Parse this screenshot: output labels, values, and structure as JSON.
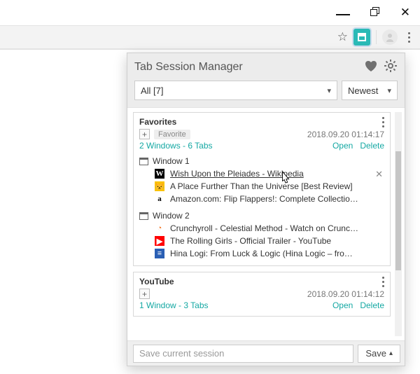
{
  "toolbar": {
    "star": "☆"
  },
  "popup": {
    "title": "Tab Session Manager",
    "filter_all": "All [7]",
    "sort": "Newest",
    "save_placeholder": "Save current session",
    "save_btn": "Save",
    "open": "Open",
    "delete": "Delete"
  },
  "sessions": [
    {
      "title": "Favorites",
      "fav_badge": "Favorite",
      "show_badge": true,
      "timestamp": "2018.09.20 01:14:17",
      "summary": "2 Windows - 6 Tabs",
      "windows": [
        {
          "label": "Window 1",
          "tabs": [
            {
              "icon": "W",
              "icon_bg": "#000",
              "icon_color": "#fff",
              "title": "Wish Upon the Pleiades - Wikipedia",
              "hover": true,
              "close": true
            },
            {
              "icon": "😾",
              "icon_bg": "#f9c200",
              "icon_color": "#000",
              "title": "A Place Further Than the Universe [Best Review]"
            },
            {
              "icon": "a",
              "icon_bg": "#fff",
              "icon_color": "#000",
              "title": "Amazon.com: Flip Flappers!: Complete Collection P…"
            }
          ]
        },
        {
          "label": "Window 2",
          "tabs": [
            {
              "icon": "◔",
              "icon_bg": "#fff",
              "icon_color": "#f47521",
              "title": "Crunchyroll - Celestial Method - Watch on Crunchyroll"
            },
            {
              "icon": "▶",
              "icon_bg": "#ff0000",
              "icon_color": "#fff",
              "title": "The Rolling Girls - Official Trailer - YouTube"
            },
            {
              "icon": "≡",
              "icon_bg": "#2a5fb4",
              "icon_color": "#fff",
              "title": "Hina Logi: From Luck & Logic (Hina Logic – from Lu…"
            }
          ]
        }
      ]
    },
    {
      "title": "YouTube",
      "show_badge": false,
      "timestamp": "2018.09.20 01:14:12",
      "summary": "1 Window - 3 Tabs",
      "windows": []
    }
  ]
}
